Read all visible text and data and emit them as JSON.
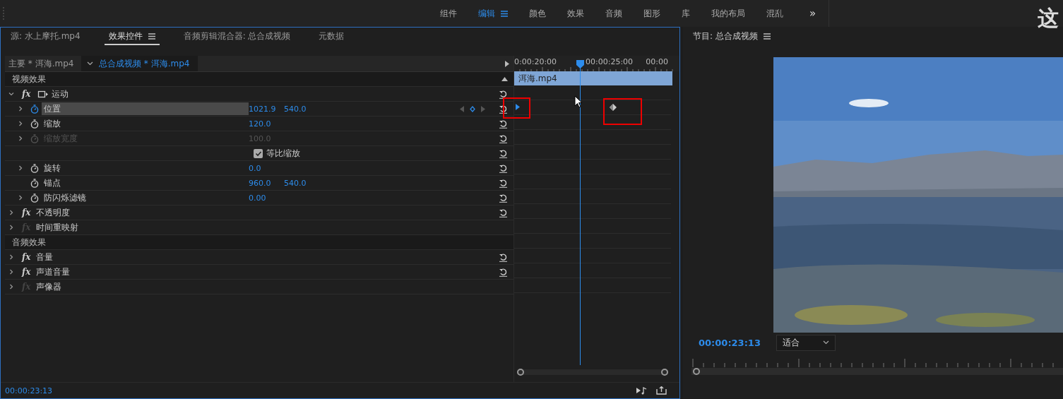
{
  "workspaces": [
    {
      "label": "组件",
      "selected": false
    },
    {
      "label": "编辑",
      "selected": true
    },
    {
      "label": "颜色",
      "selected": false
    },
    {
      "label": "效果",
      "selected": false
    },
    {
      "label": "音频",
      "selected": false
    },
    {
      "label": "图形",
      "selected": false
    },
    {
      "label": "库",
      "selected": false
    },
    {
      "label": "我的布局",
      "selected": false
    },
    {
      "label": "混乱",
      "selected": false
    }
  ],
  "more_button": "»",
  "overlay_caption": "这",
  "effect_panel": {
    "tabs": [
      {
        "label": "源: 水上摩托.mp4",
        "selected": false
      },
      {
        "label": "效果控件",
        "selected": true
      },
      {
        "label": "音频剪辑混合器: 总合成视频",
        "selected": false
      },
      {
        "label": "元数据",
        "selected": false
      }
    ],
    "master_clip": "主要 * 洱海.mp4",
    "sequence_clip": "总合成视频 * 洱海.mp4",
    "ruler_labels": [
      "0:00:20:00",
      "00:00:25:00",
      "00:00"
    ],
    "clip_label": "洱海.mp4",
    "rows": [
      {
        "kind": "section",
        "label": "视频效果"
      },
      {
        "kind": "effect",
        "badge": "fx",
        "label": "运动",
        "expanded": true,
        "enabled": true,
        "transform": true
      },
      {
        "kind": "property",
        "label": "位置",
        "values": [
          "1021.9",
          "540.0"
        ],
        "expandable": true,
        "animated": true,
        "disabled": false,
        "selected": true,
        "keyframes": true
      },
      {
        "kind": "property",
        "label": "缩放",
        "values": [
          "120.0"
        ],
        "expandable": true,
        "animated": false,
        "disabled": false,
        "selected": false,
        "keyframes": false
      },
      {
        "kind": "property",
        "label": "缩放宽度",
        "values": [
          "100.0"
        ],
        "expandable": true,
        "animated": false,
        "disabled": true,
        "selected": false,
        "keyframes": false
      },
      {
        "kind": "checkbox",
        "label": "等比缩放",
        "checked": true
      },
      {
        "kind": "property",
        "label": "旋转",
        "values": [
          "0.0"
        ],
        "expandable": true,
        "animated": false,
        "disabled": false,
        "selected": false,
        "keyframes": false
      },
      {
        "kind": "property",
        "label": "锚点",
        "values": [
          "960.0",
          "540.0"
        ],
        "expandable": false,
        "animated": false,
        "disabled": false,
        "selected": false,
        "keyframes": false
      },
      {
        "kind": "property",
        "label": "防闪烁滤镜",
        "values": [
          "0.00"
        ],
        "expandable": true,
        "animated": false,
        "disabled": false,
        "selected": false,
        "keyframes": false
      },
      {
        "kind": "effect",
        "badge": "fx",
        "label": "不透明度",
        "expanded": false,
        "enabled": true,
        "transform": false
      },
      {
        "kind": "effect",
        "badge": "fx",
        "label": "时间重映射",
        "expanded": false,
        "enabled": false,
        "transform": false
      },
      {
        "kind": "section",
        "label": "音频效果"
      },
      {
        "kind": "effect",
        "badge": "fx",
        "label": "音量",
        "expanded": false,
        "enabled": true,
        "transform": false
      },
      {
        "kind": "effect",
        "badge": "fx",
        "label": "声道音量",
        "expanded": false,
        "enabled": true,
        "transform": false
      },
      {
        "kind": "effect",
        "badge": "fx",
        "label": "声像器",
        "expanded": false,
        "enabled": false,
        "transform": false
      }
    ],
    "timecode": "00:00:23:13"
  },
  "program_panel": {
    "title": "节目: 总合成视频",
    "timecode": "00:00:23:13",
    "zoom": "适合"
  }
}
